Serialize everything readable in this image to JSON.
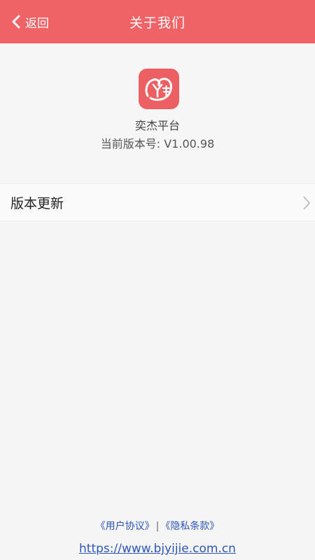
{
  "header": {
    "back_label": "返回",
    "title": "关于我们"
  },
  "about": {
    "app_name": "奕杰平台",
    "version": "当前版本号: V1.00.98",
    "logo_icon": "yijie-logo-icon"
  },
  "settings": {
    "update_label": "版本更新"
  },
  "footer": {
    "user_agreement": "《用户协议》",
    "separator": "|",
    "privacy": "《隐私条款》",
    "url": "https://www.bjyijie.com.cn"
  },
  "colors": {
    "brand": "#ef6266",
    "link": "#2f57b8",
    "background": "#f5f5f5"
  }
}
